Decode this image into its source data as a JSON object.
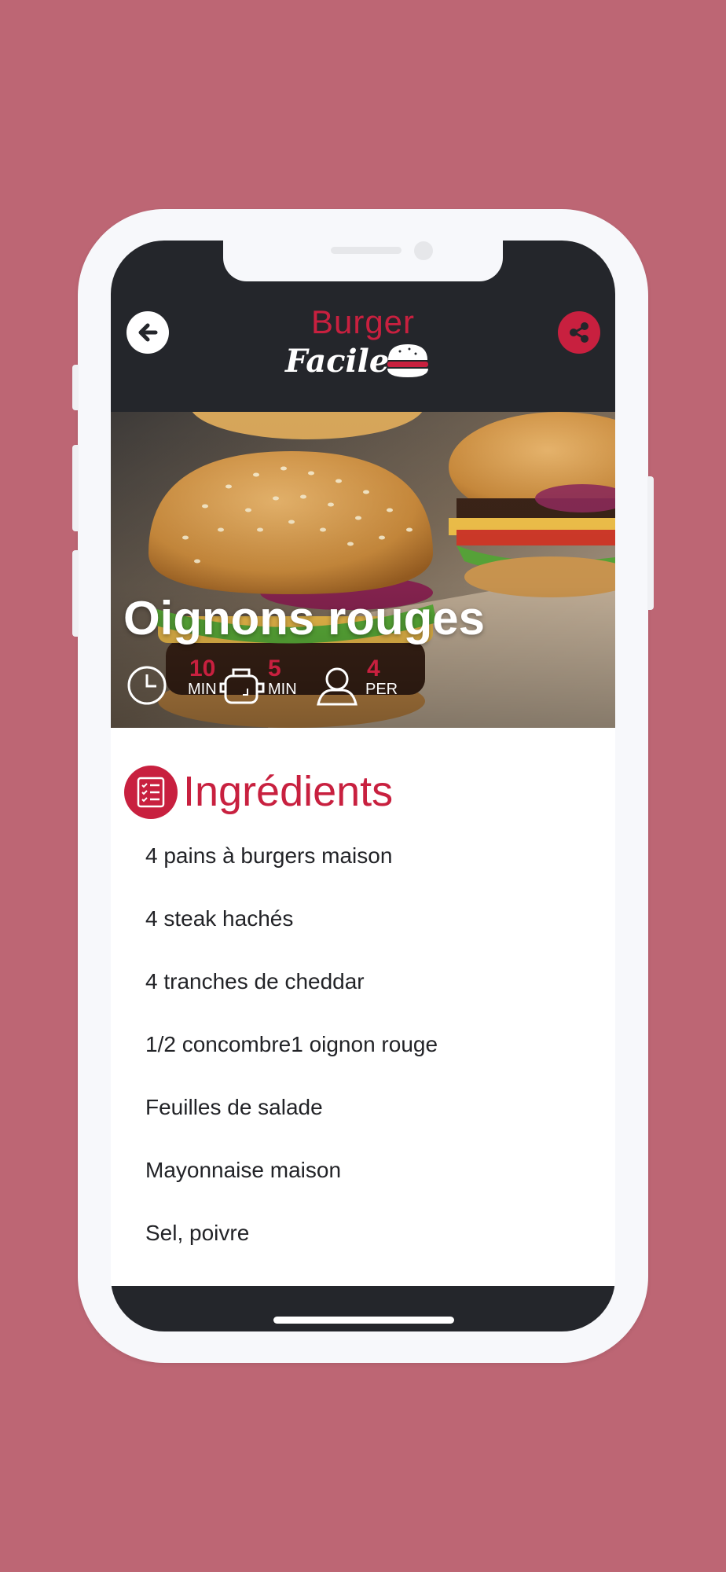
{
  "header": {
    "logo_top": "Burger",
    "logo_bottom": "Facile",
    "back_icon": "arrow-left-icon",
    "share_icon": "share-icon"
  },
  "recipe": {
    "title": "Oignons rouges",
    "prep": {
      "value": "10",
      "unit": "MIN",
      "icon": "clock-icon"
    },
    "cook": {
      "value": "5",
      "unit": "MIN",
      "icon": "pot-icon"
    },
    "people": {
      "value": "4",
      "unit": "PER",
      "icon": "person-icon"
    }
  },
  "ingredients": {
    "title": "Ingrédients",
    "icon": "checklist-icon",
    "items": [
      "4 pains à burgers maison",
      "4 steak hachés",
      "4 tranches de cheddar",
      "1/2 concombre1 oignon rouge",
      "Feuilles de salade",
      "Mayonnaise maison",
      "Sel, poivre"
    ]
  },
  "colors": {
    "background": "#bd6674",
    "accent": "#c8203f",
    "dark": "#24262b"
  }
}
